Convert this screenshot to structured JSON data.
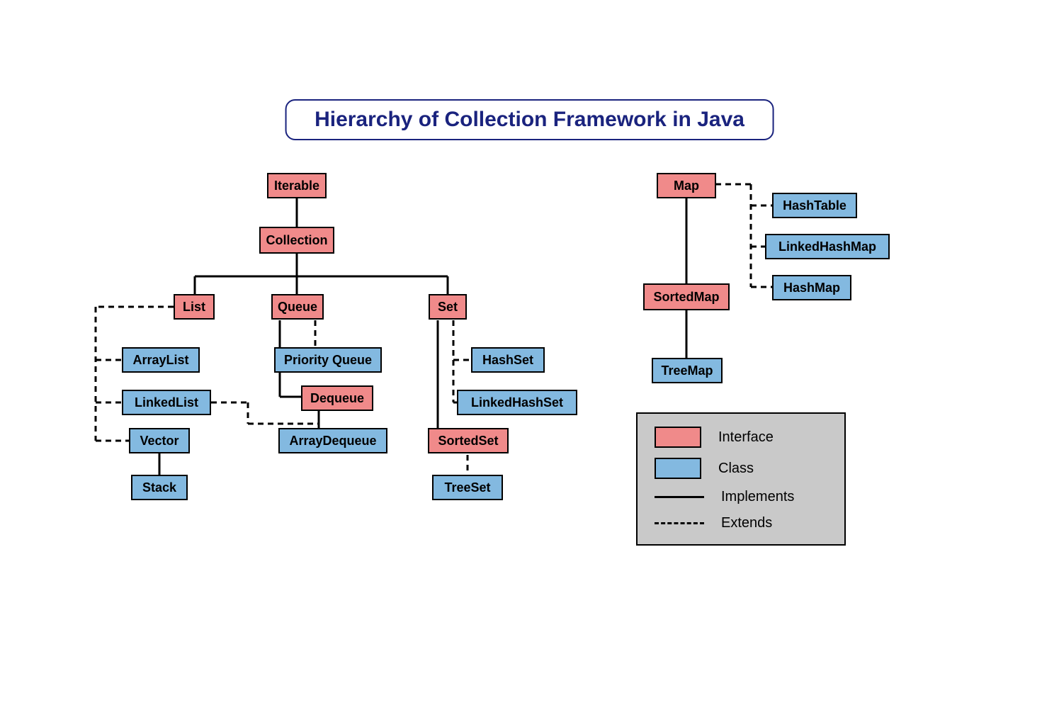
{
  "title": "Hierarchy of Collection Framework in Java",
  "nodes": {
    "iterable": "Iterable",
    "collection": "Collection",
    "list": "List",
    "queue": "Queue",
    "set": "Set",
    "arraylist": "ArrayList",
    "linkedlist": "LinkedList",
    "vector": "Vector",
    "stack": "Stack",
    "priorityqueue": "Priority Queue",
    "dequeue": "Dequeue",
    "arraydequeue": "ArrayDequeue",
    "hashset": "HashSet",
    "linkedhashset": "LinkedHashSet",
    "sortedset": "SortedSet",
    "treeset": "TreeSet",
    "map": "Map",
    "sortedmap": "SortedMap",
    "treemap": "TreeMap",
    "hashtable": "HashTable",
    "linkedhashmap": "LinkedHashMap",
    "hashmap": "HashMap"
  },
  "legend": {
    "interface": "Interface",
    "class": "Class",
    "implements": "Implements",
    "extends": "Extends"
  }
}
